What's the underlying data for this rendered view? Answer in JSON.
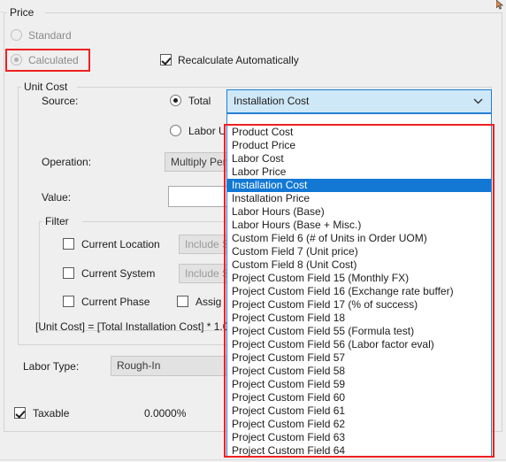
{
  "window": {
    "price_group_title": "Price",
    "unit_cost_group_title": "Unit Cost",
    "filter_group_title": "Filter"
  },
  "price": {
    "standard_label": "Standard",
    "calculated_label": "Calculated",
    "recalculate_label": "Recalculate Automatically"
  },
  "unit_cost": {
    "source_label": "Source:",
    "total_label": "Total",
    "labor_unit_label": "Labor U",
    "operation_label": "Operation:",
    "operation_value": "Multiply Per",
    "value_label": "Value:",
    "value_text": "",
    "source_combo_value": "Installation Cost",
    "chevron_icon": "chevron-down-icon"
  },
  "filter": {
    "current_location_label": "Current Location",
    "current_location_value": "Include S",
    "current_system_label": "Current System",
    "current_system_value": "Include S",
    "current_phase_label": "Current Phase",
    "assign_label": "Assig"
  },
  "formula": {
    "text": "[Unit Cost] = [Total Installation Cost] * 1.0"
  },
  "labor": {
    "type_label": "Labor Type:",
    "type_value": "Rough-In"
  },
  "tax": {
    "taxable_label": "Taxable",
    "rate_value": "0.0000%"
  },
  "dropdown": {
    "selected_index": 4,
    "items": [
      "Product Cost",
      "Product Price",
      "Labor Cost",
      "Labor Price",
      "Installation Cost",
      "Installation Price",
      "Labor Hours (Base)",
      "Labor Hours (Base + Misc.)",
      "Custom Field 6 (# of Units in Order UOM)",
      "Custom Field 7 (Unit price)",
      "Custom Field 8 (Unit Cost)",
      "Project Custom Field 15 (Monthly FX)",
      "Project Custom Field 16 (Exchange rate buffer)",
      "Project Custom Field 17 (% of success)",
      "Project Custom Field 18",
      "Project Custom Field 55 (Formula test)",
      "Project Custom Field 56 (Labor factor eval)",
      "Project Custom Field 57",
      "Project Custom Field 58",
      "Project Custom Field 59",
      "Project Custom Field 60",
      "Project Custom Field 61",
      "Project Custom Field 62",
      "Project Custom Field 63",
      "Project Custom Field 64"
    ]
  },
  "colors": {
    "accent_selection": "#1278d4",
    "annotation": "#f02020",
    "combo_focus_bg": "#cfe8f8",
    "panel_bg": "#efefef"
  }
}
